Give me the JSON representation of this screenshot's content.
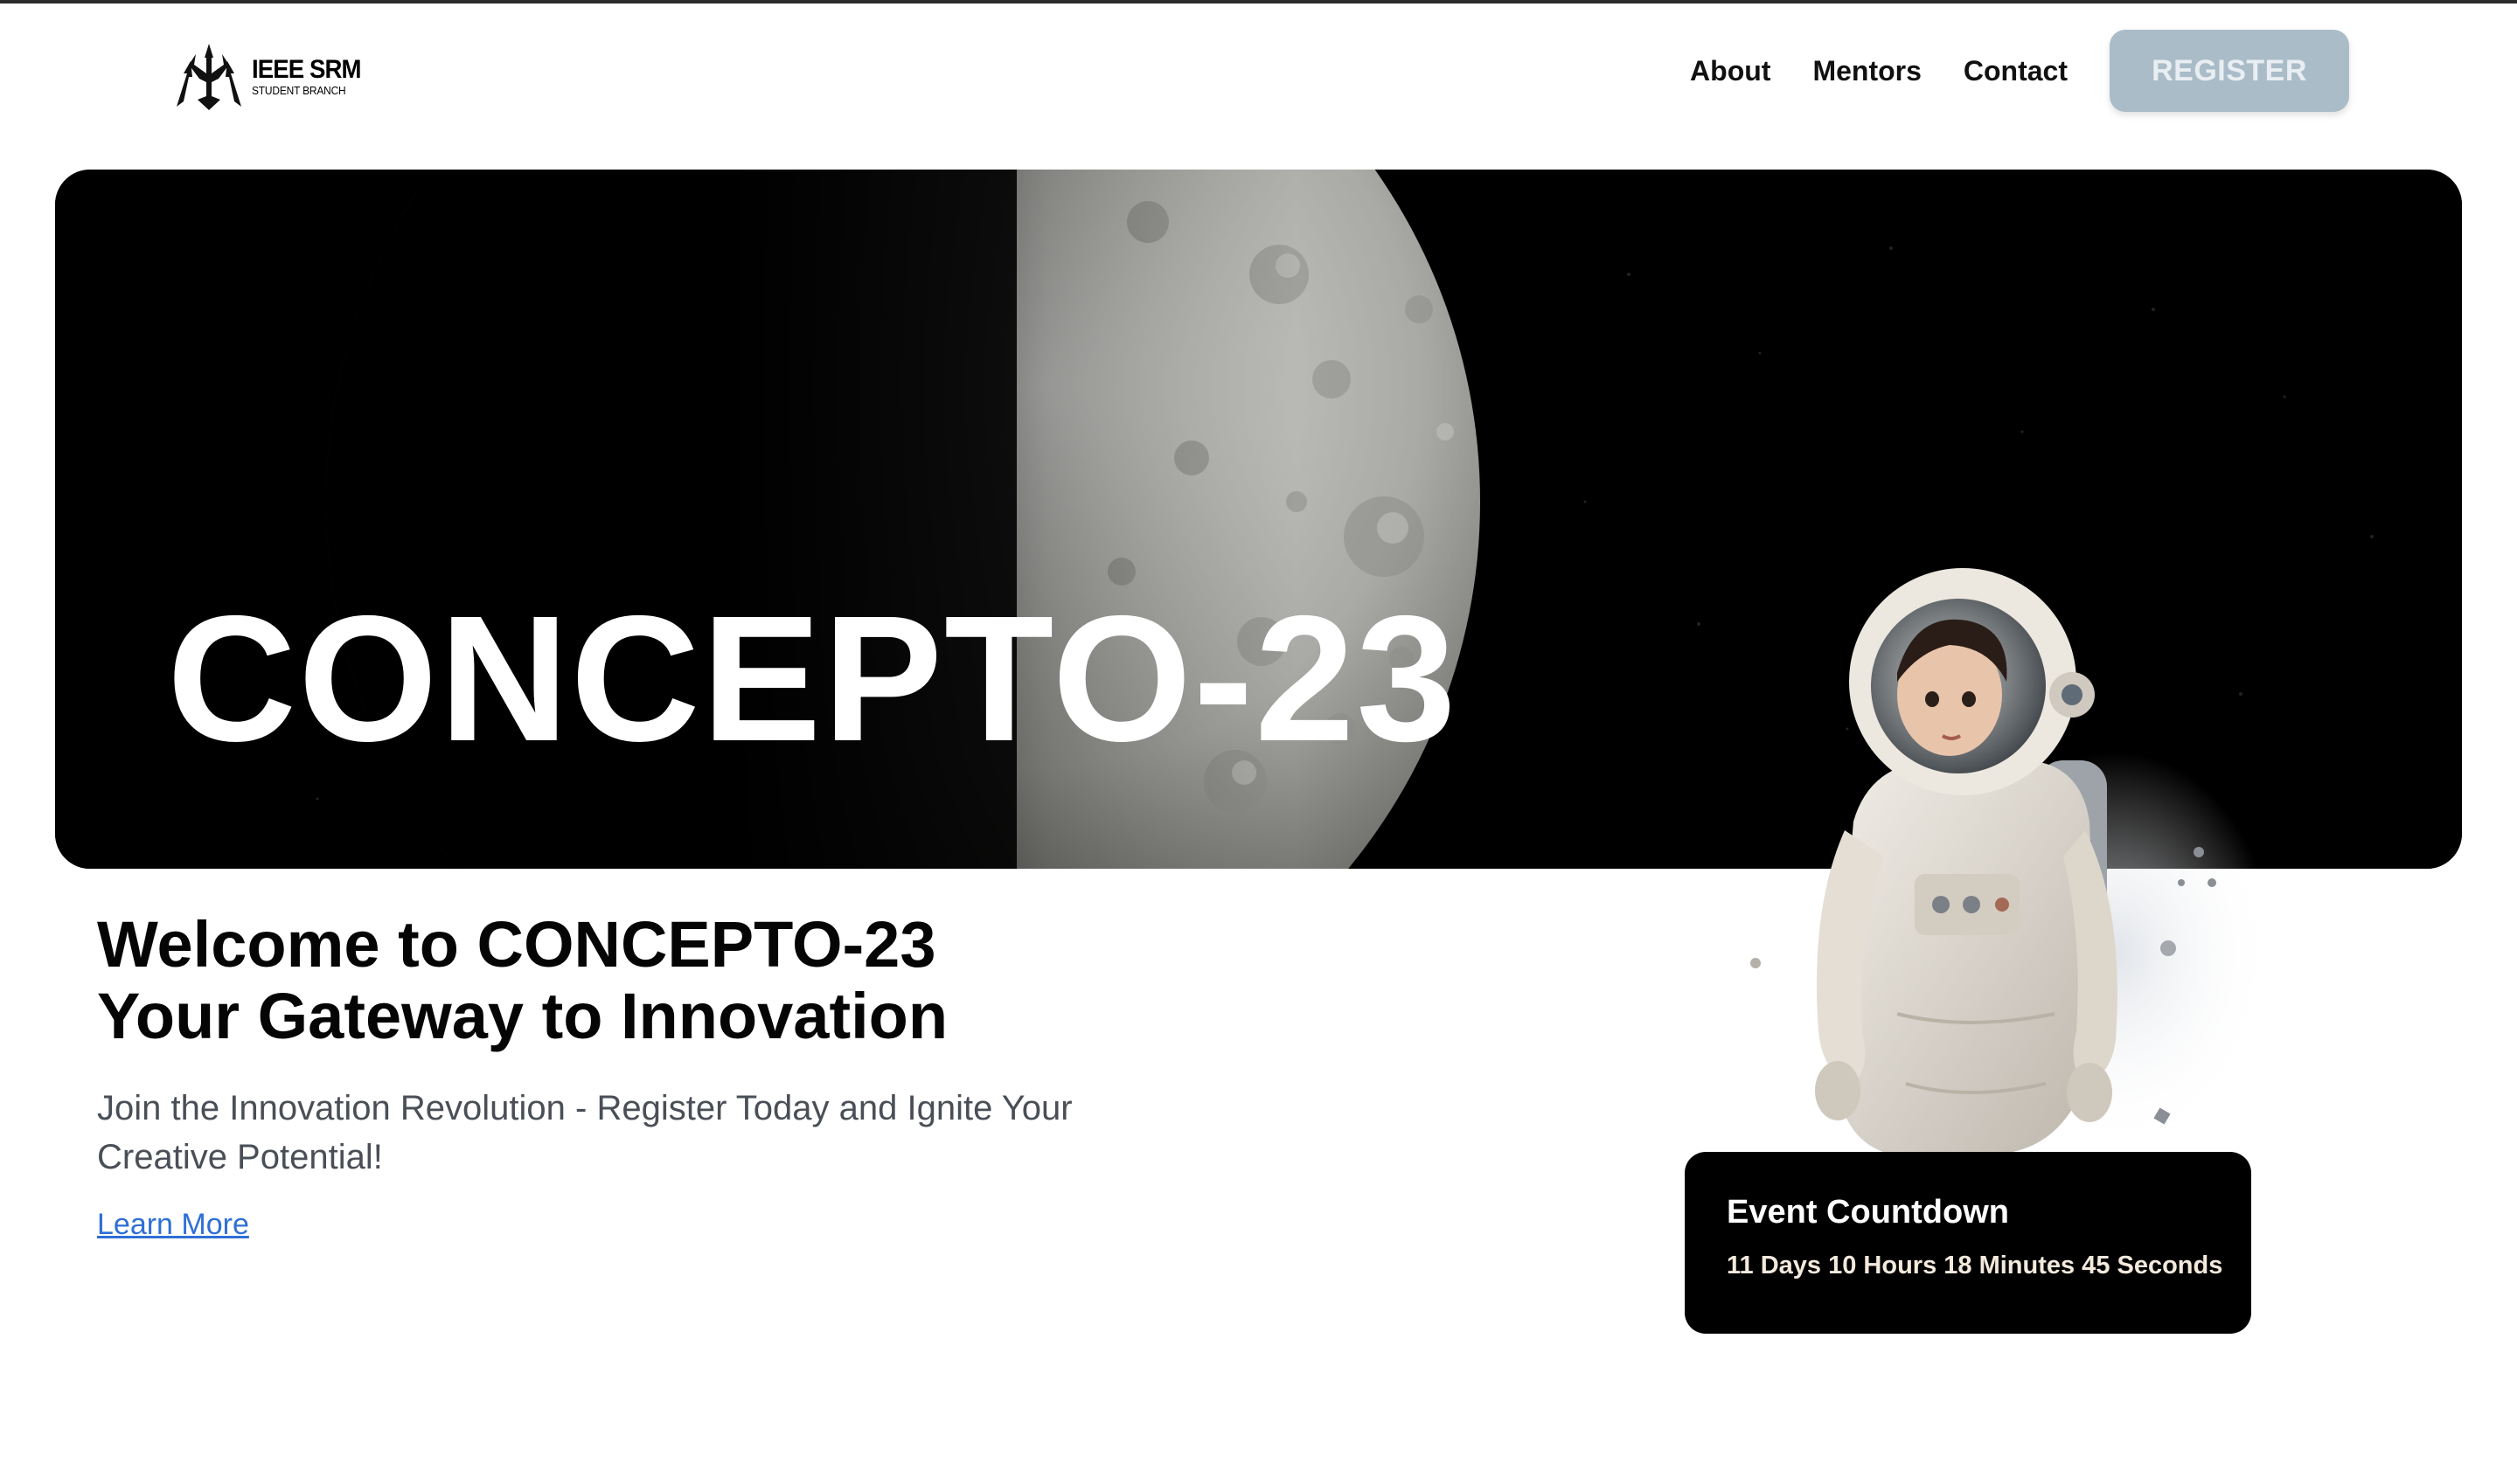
{
  "nav": {
    "logo_title": "IEEE SRM",
    "logo_subtitle": "STUDENT BRANCH",
    "links": [
      {
        "label": "About"
      },
      {
        "label": "Mentors"
      },
      {
        "label": "Contact"
      }
    ],
    "register_label": "REGISTER"
  },
  "hero": {
    "title": "CONCEPTO-23"
  },
  "welcome": {
    "line1_prefix": "Welcome to ",
    "line1_brand": "CONCEPTO-23",
    "line2": "Your Gateway to Innovation",
    "description": "Join the Innovation Revolution - Register Today and Ignite Your Creative Potential!",
    "learn_more": "Learn More"
  },
  "countdown": {
    "title": "Event Countdown",
    "value": "11 Days 10 Hours 18 Minutes 45 Seconds"
  },
  "colors": {
    "register_bg": "#a9bcc8",
    "link": "#2f6fd6",
    "hero_bg": "#000000"
  }
}
